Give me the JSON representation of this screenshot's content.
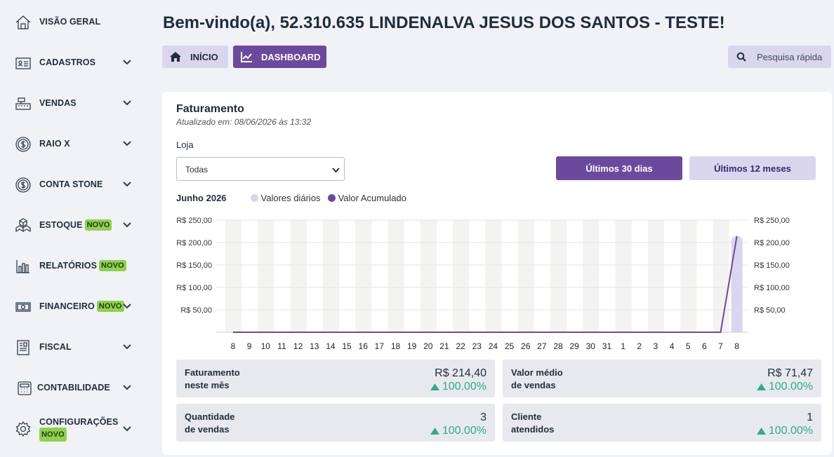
{
  "sidebar": {
    "items": [
      {
        "label": "VISÃO GERAL",
        "icon": "house-icon",
        "badge": "",
        "chevron": false
      },
      {
        "label": "CADASTROS",
        "icon": "id-card-icon",
        "badge": "",
        "chevron": true
      },
      {
        "label": "VENDAS",
        "icon": "cash-register-icon",
        "badge": "",
        "chevron": true
      },
      {
        "label": "RAIO X",
        "icon": "dollar-cycle-icon",
        "badge": "",
        "chevron": true
      },
      {
        "label": "CONTA STONE",
        "icon": "dollar-cycle-icon",
        "badge": "",
        "chevron": true
      },
      {
        "label": "ESTOQUE",
        "icon": "boxes-icon",
        "badge": "NOVO",
        "chevron": true
      },
      {
        "label": "RELATÓRIOS",
        "icon": "bar-chart-icon",
        "badge": "NOVO",
        "chevron": false
      },
      {
        "label": "FINANCEIRO",
        "icon": "money-bill-icon",
        "badge": "NOVO",
        "chevron": true
      },
      {
        "label": "FISCAL",
        "icon": "receipt-icon",
        "badge": "",
        "chevron": true
      },
      {
        "label": "CONTABILIDADE",
        "icon": "calculator-icon",
        "badge": "",
        "chevron": true
      },
      {
        "label": "CONFIGURAÇÕES",
        "icon": "gear-icon",
        "badge": "NOVO",
        "chevron": true
      }
    ]
  },
  "header": {
    "title": "Bem-vindo(a), 52.310.635 LINDENALVA JESUS DOS SANTOS - TESTE!",
    "inicio_label": "INÍCIO",
    "dashboard_label": "DASHBOARD",
    "search_label": "Pesquisa rápida"
  },
  "card": {
    "title": "Faturamento",
    "subtitle": "Atualizado em: 08/06/2026 às 13:32",
    "loja_label": "Loja",
    "loja_value": "Todas",
    "period_30": "Últimos 30 dias",
    "period_12": "Últimos 12 meses",
    "month": "Junho 2026",
    "legend_daily": "Valores diários",
    "legend_acc": "Valor Acumulado"
  },
  "colors": {
    "accent": "#6b4a9e",
    "daily": "#d9d6ee",
    "positive": "#2daf86"
  },
  "chart_data": {
    "type": "bar",
    "categories": [
      "8",
      "9",
      "10",
      "11",
      "12",
      "13",
      "14",
      "15",
      "16",
      "17",
      "18",
      "19",
      "20",
      "21",
      "22",
      "23",
      "24",
      "25",
      "26",
      "27",
      "28",
      "29",
      "30",
      "31",
      "1",
      "2",
      "3",
      "4",
      "5",
      "6",
      "7",
      "8"
    ],
    "series": [
      {
        "name": "Valores diários",
        "type": "bar",
        "values": [
          0,
          0,
          0,
          0,
          0,
          0,
          0,
          0,
          0,
          0,
          0,
          0,
          0,
          0,
          0,
          0,
          0,
          0,
          0,
          0,
          0,
          0,
          0,
          0,
          0,
          0,
          0,
          0,
          0,
          0,
          0,
          214.4
        ]
      },
      {
        "name": "Valor Acumulado",
        "type": "line",
        "values": [
          0,
          0,
          0,
          0,
          0,
          0,
          0,
          0,
          0,
          0,
          0,
          0,
          0,
          0,
          0,
          0,
          0,
          0,
          0,
          0,
          0,
          0,
          0,
          0,
          0,
          0,
          0,
          0,
          0,
          0,
          0,
          214.4
        ]
      }
    ],
    "ylim": [
      0,
      250
    ],
    "yticks": [
      "R$ 50,00",
      "R$ 100,00",
      "R$ 150,00",
      "R$ 200,00",
      "R$ 250,00"
    ],
    "grid": true
  },
  "stats": [
    {
      "label1": "Faturamento",
      "label2": "neste mês",
      "value": "R$ 214,40",
      "change": "100.00%"
    },
    {
      "label1": "Valor médio",
      "label2": "de vendas",
      "value": "R$ 71,47",
      "change": "100.00%"
    },
    {
      "label1": "Quantidade",
      "label2": "de vendas",
      "value": "3",
      "change": "100.00%"
    },
    {
      "label1": "Cliente",
      "label2": "atendidos",
      "value": "1",
      "change": "100.00%"
    }
  ]
}
